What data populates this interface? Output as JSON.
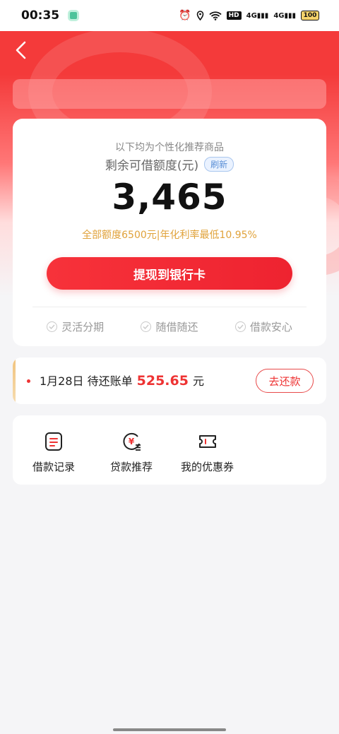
{
  "status_bar": {
    "time": "00:35",
    "hd": "HD",
    "signal1": "4G",
    "signal2": "4G",
    "battery": "100"
  },
  "main_card": {
    "recommend_text": "以下均为个性化推荐商品",
    "quota_label": "剩余可借额度(元)",
    "refresh_label": "刷新",
    "amount": "3,465",
    "amount_sub": "全部额度6500元|年化利率最低10.95%",
    "cta_label": "提现到银行卡",
    "features": [
      "灵活分期",
      "随借随还",
      "借款安心"
    ]
  },
  "bill": {
    "date_text": "1月28日 待还账单",
    "amount": "525.65",
    "unit": "元",
    "pay_label": "去还款"
  },
  "quick_entries": [
    {
      "label": "借款记录",
      "icon": "document-icon"
    },
    {
      "label": "贷款推荐",
      "icon": "yuan-coin-icon"
    },
    {
      "label": "我的优惠券",
      "icon": "ticket-icon"
    }
  ],
  "colors": {
    "brand_red": "#ee2330",
    "accent_gold": "#e0a23a",
    "refresh_blue": "#5b8fd6"
  }
}
